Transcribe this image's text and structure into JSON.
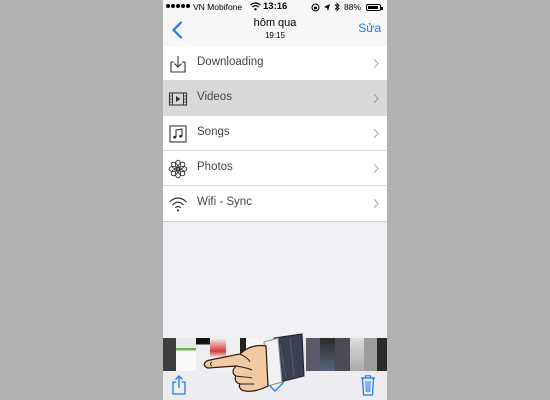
{
  "status_bar": {
    "carrier": "VN Mobifone",
    "time": "13:16",
    "battery_percent": "88%",
    "battery_level": 0.88
  },
  "nav": {
    "title": "hôm qua",
    "subtitle": "19:15",
    "edit_label": "Sửa"
  },
  "list": {
    "items": [
      {
        "label": "Downloading",
        "icon": "download-icon",
        "selected": false
      },
      {
        "label": "Videos",
        "icon": "film-icon",
        "selected": true
      },
      {
        "label": "Songs",
        "icon": "music-icon",
        "selected": false
      },
      {
        "label": "Photos",
        "icon": "flower-icon",
        "selected": false
      },
      {
        "label": "Wifi - Sync",
        "icon": "wifi-icon",
        "selected": false
      }
    ]
  },
  "toolbar": {
    "icons": [
      "share-icon",
      "heart-icon",
      "trash-icon"
    ]
  },
  "colors": {
    "accent": "#1c7cf4",
    "selected_row": "#d9d9d9",
    "background": "#efeff4"
  }
}
